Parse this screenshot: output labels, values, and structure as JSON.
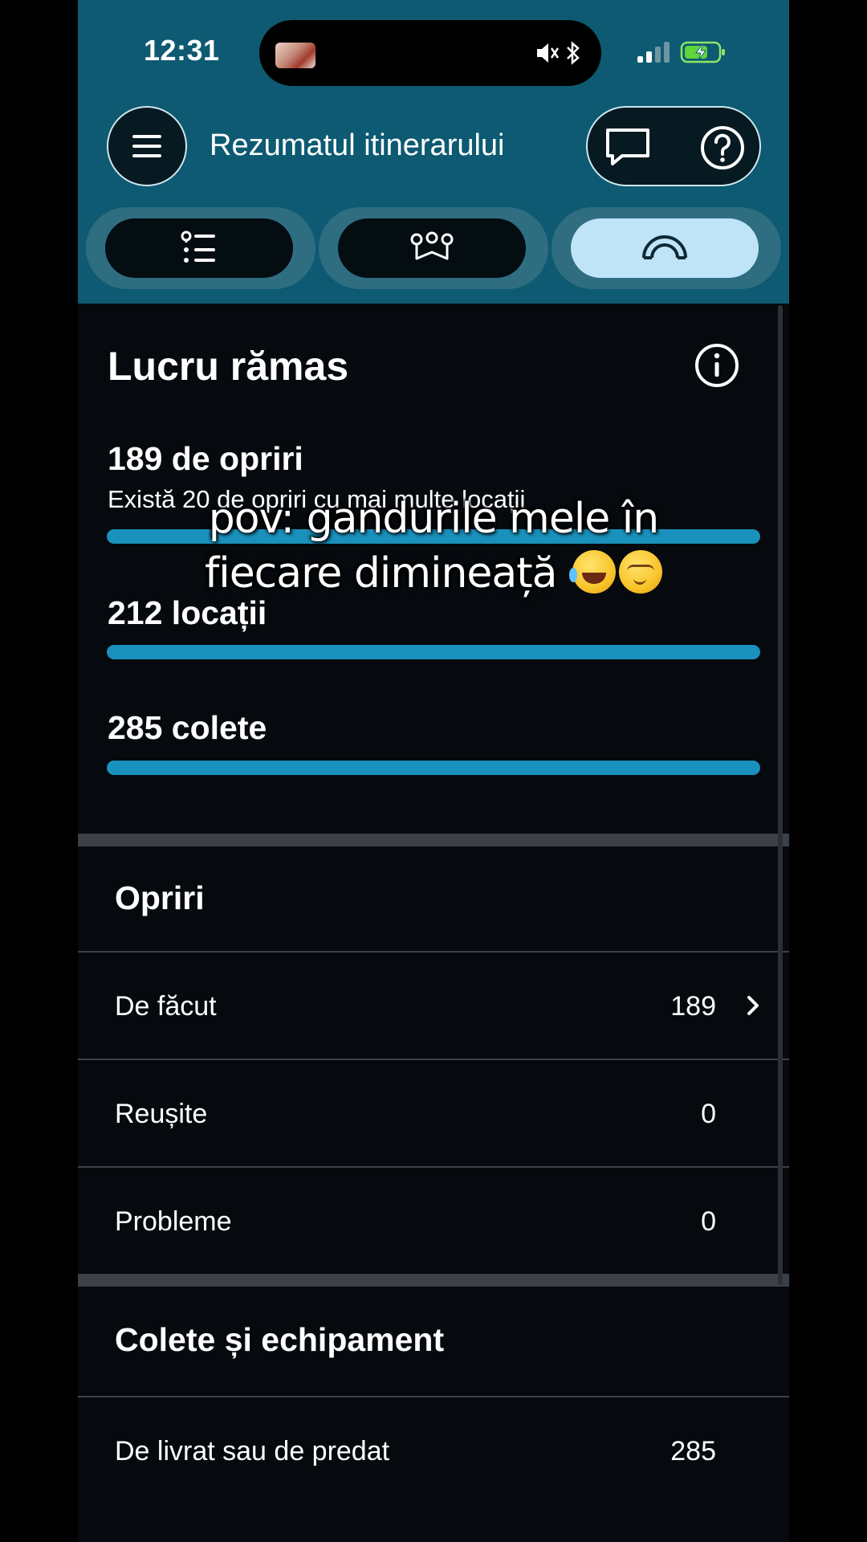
{
  "status_bar": {
    "time": "12:31"
  },
  "header": {
    "title": "Rezumatul itinerarului",
    "icons": [
      "menu-icon",
      "chat-icon",
      "help-icon"
    ]
  },
  "tabs": [
    {
      "icon": "stop-list-icon",
      "active": false
    },
    {
      "icon": "route-map-icon",
      "active": false
    },
    {
      "icon": "summary-gauge-icon",
      "active": true
    }
  ],
  "remaining_work": {
    "title": "Lucru rămas",
    "stops": {
      "title": "189 de opriri",
      "subtitle": "Există 20 de opriri cu mai multe locații",
      "progress": 1.0
    },
    "locations": {
      "title": "212 locații",
      "progress": 1.0
    },
    "packages": {
      "title": "285 colete",
      "progress": 1.0
    }
  },
  "stops_section": {
    "title": "Opriri",
    "rows": [
      {
        "label": "De făcut",
        "value": "189",
        "has_chevron": true
      },
      {
        "label": "Reușite",
        "value": "0",
        "has_chevron": false
      },
      {
        "label": "Probleme",
        "value": "0",
        "has_chevron": false
      }
    ]
  },
  "packages_section": {
    "title": "Colete și echipament",
    "rows": [
      {
        "label": "De livrat sau de predat",
        "value": "285"
      }
    ]
  },
  "overlay_caption": {
    "line1": "pov: gandurile mele în",
    "line2": "fiecare dimineață"
  },
  "colors": {
    "header_bg": "#0d5a72",
    "page_bg": "#060a0e",
    "progress_fill": "#1a91bd",
    "active_tab": "#bfe3f7"
  }
}
